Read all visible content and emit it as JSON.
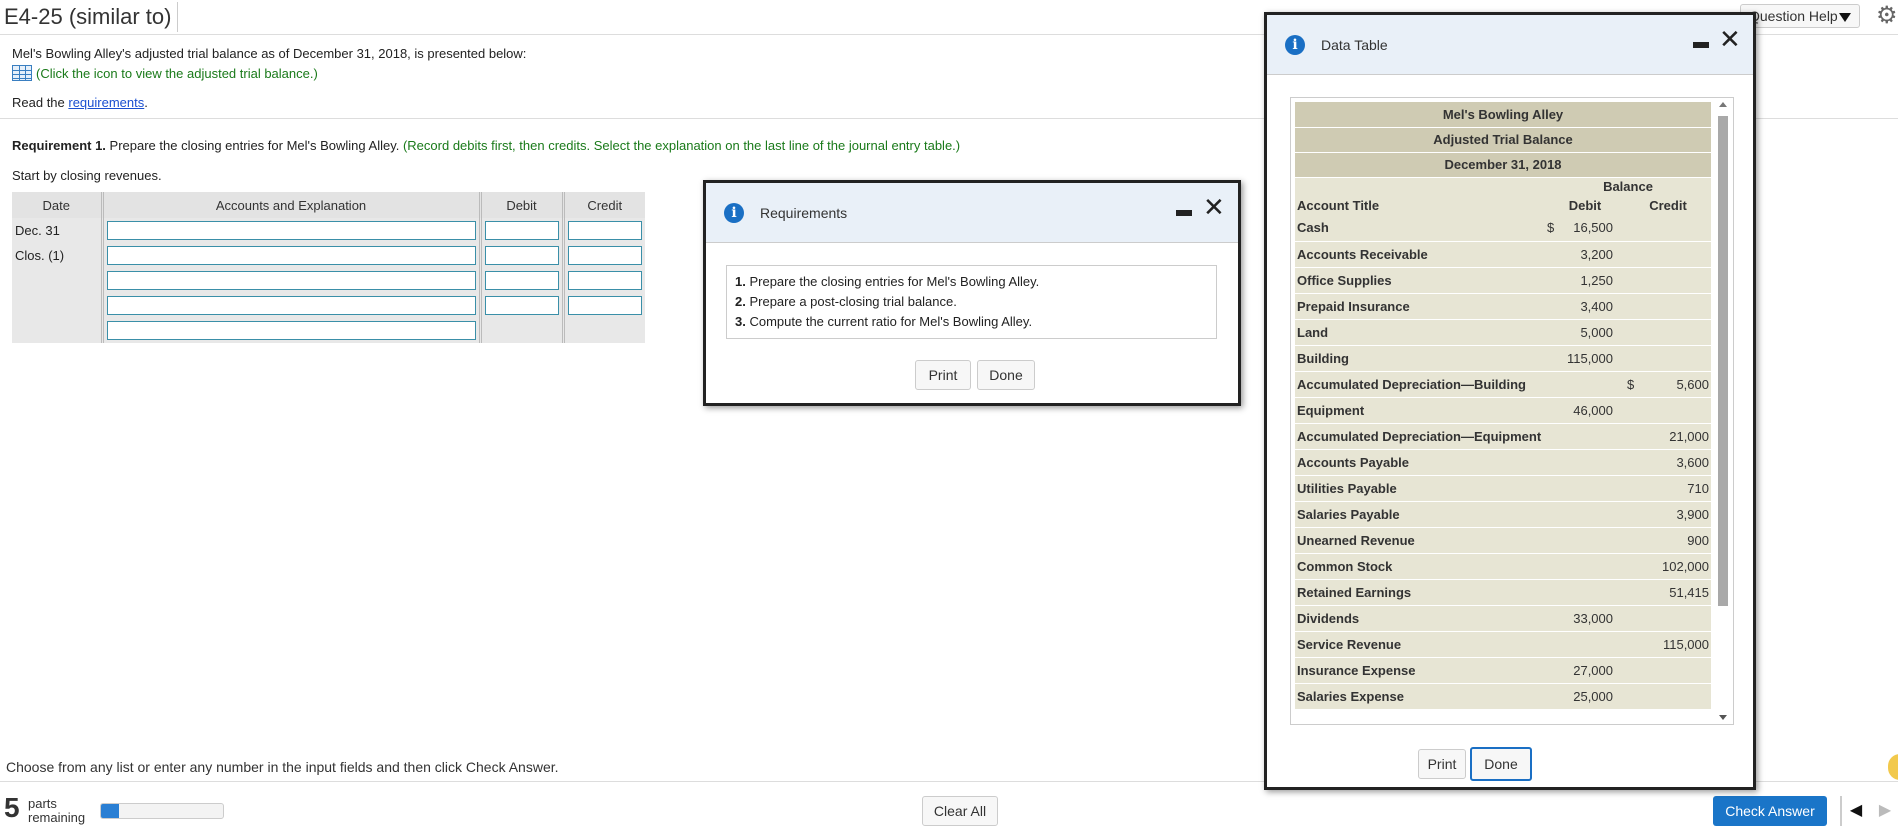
{
  "header": {
    "title": "E4-25 (similar to)",
    "help_label": "Question Help"
  },
  "intro": {
    "text": "Mel's Bowling Alley's adjusted trial balance as of December 31, 2018, is presented below:",
    "data_link": "(Click the icon to view the adjusted trial balance.)",
    "read_prefix": "Read the ",
    "req_link": "requirements",
    "read_suffix": "."
  },
  "requirement": {
    "label": "Requirement 1.",
    "text": " Prepare the closing entries for Mel's Bowling Alley. ",
    "note": "(Record debits first, then credits. Select the explanation on the last line of the journal entry table.)",
    "start": "Start by closing revenues."
  },
  "journal": {
    "headers": [
      "Date",
      "Accounts and Explanation",
      "Debit",
      "Credit"
    ],
    "date_line1": "Dec. 31",
    "date_line2": "Clos. (1)"
  },
  "footer": {
    "hint": "Choose from any list or enter any number in the input fields and then click Check Answer.",
    "parts_num": "5",
    "parts_line1": "parts",
    "parts_line2": "remaining",
    "progress": 0.15,
    "clear_all": "Clear All",
    "check_answer": "Check Answer"
  },
  "req_modal": {
    "title": "Requirements",
    "items": [
      {
        "n": "1.",
        "text": "Prepare the closing entries for Mel's Bowling Alley."
      },
      {
        "n": "2.",
        "text": "Prepare a post-closing trial balance."
      },
      {
        "n": "3.",
        "text": "Compute the current ratio for Mel's Bowling Alley."
      }
    ],
    "print": "Print",
    "done": "Done"
  },
  "data_table": {
    "title": "Data Table",
    "company": "Mel's Bowling Alley",
    "report": "Adjusted Trial Balance",
    "date": "December 31, 2018",
    "balance_label": "Balance",
    "col_account": "Account Title",
    "col_debit": "Debit",
    "col_credit": "Credit",
    "rows": [
      {
        "account": "Cash",
        "debit": "16,500",
        "credit": "",
        "dsign": "$",
        "csign": ""
      },
      {
        "account": "Accounts Receivable",
        "debit": "3,200",
        "credit": "",
        "dsign": "",
        "csign": ""
      },
      {
        "account": "Office Supplies",
        "debit": "1,250",
        "credit": "",
        "dsign": "",
        "csign": ""
      },
      {
        "account": "Prepaid Insurance",
        "debit": "3,400",
        "credit": "",
        "dsign": "",
        "csign": ""
      },
      {
        "account": "Land",
        "debit": "5,000",
        "credit": "",
        "dsign": "",
        "csign": ""
      },
      {
        "account": "Building",
        "debit": "115,000",
        "credit": "",
        "dsign": "",
        "csign": ""
      },
      {
        "account": "Accumulated Depreciation—Building",
        "debit": "",
        "credit": "5,600",
        "dsign": "",
        "csign": "$"
      },
      {
        "account": "Equipment",
        "debit": "46,000",
        "credit": "",
        "dsign": "",
        "csign": ""
      },
      {
        "account": "Accumulated Depreciation—Equipment",
        "debit": "",
        "credit": "21,000",
        "dsign": "",
        "csign": ""
      },
      {
        "account": "Accounts Payable",
        "debit": "",
        "credit": "3,600",
        "dsign": "",
        "csign": ""
      },
      {
        "account": "Utilities Payable",
        "debit": "",
        "credit": "710",
        "dsign": "",
        "csign": ""
      },
      {
        "account": "Salaries Payable",
        "debit": "",
        "credit": "3,900",
        "dsign": "",
        "csign": ""
      },
      {
        "account": "Unearned Revenue",
        "debit": "",
        "credit": "900",
        "dsign": "",
        "csign": ""
      },
      {
        "account": "Common Stock",
        "debit": "",
        "credit": "102,000",
        "dsign": "",
        "csign": ""
      },
      {
        "account": "Retained Earnings",
        "debit": "",
        "credit": "51,415",
        "dsign": "",
        "csign": ""
      },
      {
        "account": "Dividends",
        "debit": "33,000",
        "credit": "",
        "dsign": "",
        "csign": ""
      },
      {
        "account": "Service Revenue",
        "debit": "",
        "credit": "115,000",
        "dsign": "",
        "csign": ""
      },
      {
        "account": "Insurance Expense",
        "debit": "27,000",
        "credit": "",
        "dsign": "",
        "csign": ""
      },
      {
        "account": "Salaries Expense",
        "debit": "25,000",
        "credit": "",
        "dsign": "",
        "csign": ""
      }
    ],
    "print": "Print",
    "done": "Done"
  }
}
